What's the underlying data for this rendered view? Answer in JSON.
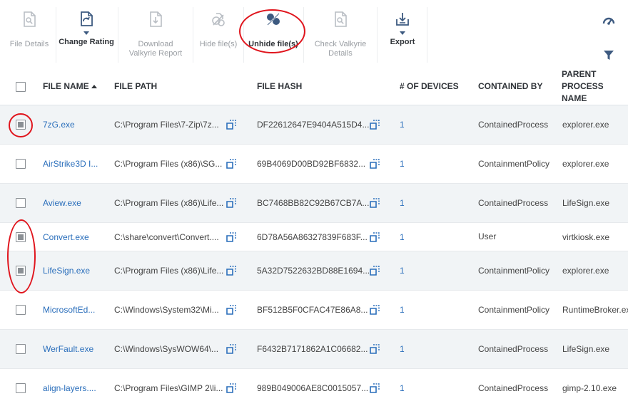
{
  "toolbar": {
    "file_details": "File Details",
    "change_rating": "Change Rating",
    "download_valkyrie_l1": "Download",
    "download_valkyrie_l2": "Valkyrie Report",
    "hide_files": "Hide file(s)",
    "unhide_files": "Unhide file(s)",
    "check_valkyrie_l1": "Check Valkyrie",
    "check_valkyrie_l2": "Details",
    "export": "Export"
  },
  "columns": {
    "file_name": "FILE NAME",
    "file_path": "FILE PATH",
    "file_hash": "FILE HASH",
    "devices": "# OF DEVICES",
    "contained_by": "CONTAINED BY",
    "parent_l1": "PARENT",
    "parent_l2": "PROCESS NAME"
  },
  "rows": [
    {
      "checked": true,
      "name": "7zG.exe",
      "path": "C:\\Program Files\\7-Zip\\7z...",
      "hash": "DF22612647E9404A515D4...",
      "devices": "1",
      "contained_l1": "Contained",
      "contained_l2": "Process",
      "parent": "explorer.exe"
    },
    {
      "checked": false,
      "name": "AirStrike3D I...",
      "path": "C:\\Program Files (x86)\\SG...",
      "hash": "69B4069D00BD92BF6832...",
      "devices": "1",
      "contained_l1": "Containment",
      "contained_l2": "Policy",
      "parent": "explorer.exe"
    },
    {
      "checked": false,
      "name": "Aview.exe",
      "path": "C:\\Program Files (x86)\\Life...",
      "hash": "BC7468BB82C92B67CB7A...",
      "devices": "1",
      "contained_l1": "Contained",
      "contained_l2": "Process",
      "parent": "LifeSign.exe"
    },
    {
      "checked": true,
      "name": "Convert.exe",
      "path": "C:\\share\\convert\\Convert....",
      "hash": "6D78A56A86327839F683F...",
      "devices": "1",
      "contained_l1": "User",
      "contained_l2": "",
      "parent": "virtkiosk.exe"
    },
    {
      "checked": true,
      "name": "LifeSign.exe",
      "path": "C:\\Program Files (x86)\\Life...",
      "hash": "5A32D7522632BD88E1694...",
      "devices": "1",
      "contained_l1": "Containment",
      "contained_l2": "Policy",
      "parent": "explorer.exe"
    },
    {
      "checked": false,
      "name": "MicrosoftEd...",
      "path": "C:\\Windows\\System32\\Mi...",
      "hash": "BF512B5F0CFAC47E86A8...",
      "devices": "1",
      "contained_l1": "Containment",
      "contained_l2": "Policy",
      "parent": "RuntimeBroker.ex"
    },
    {
      "checked": false,
      "name": "WerFault.exe",
      "path": "C:\\Windows\\SysWOW64\\...",
      "hash": "F6432B7171862A1C06682...",
      "devices": "1",
      "contained_l1": "Contained",
      "contained_l2": "Process",
      "parent": "LifeSign.exe"
    },
    {
      "checked": false,
      "name": "align-layers....",
      "path": "C:\\Program Files\\GIMP 2\\li...",
      "hash": "989B049006AE8C0015057...",
      "devices": "1",
      "contained_l1": "Contained",
      "contained_l2": "Process",
      "parent": "gimp-2.10.exe"
    }
  ],
  "colors": {
    "link": "#2a6ebb",
    "icon": "#3d5a80",
    "highlight": "#e0151d",
    "row_alt": "#f1f4f6"
  }
}
